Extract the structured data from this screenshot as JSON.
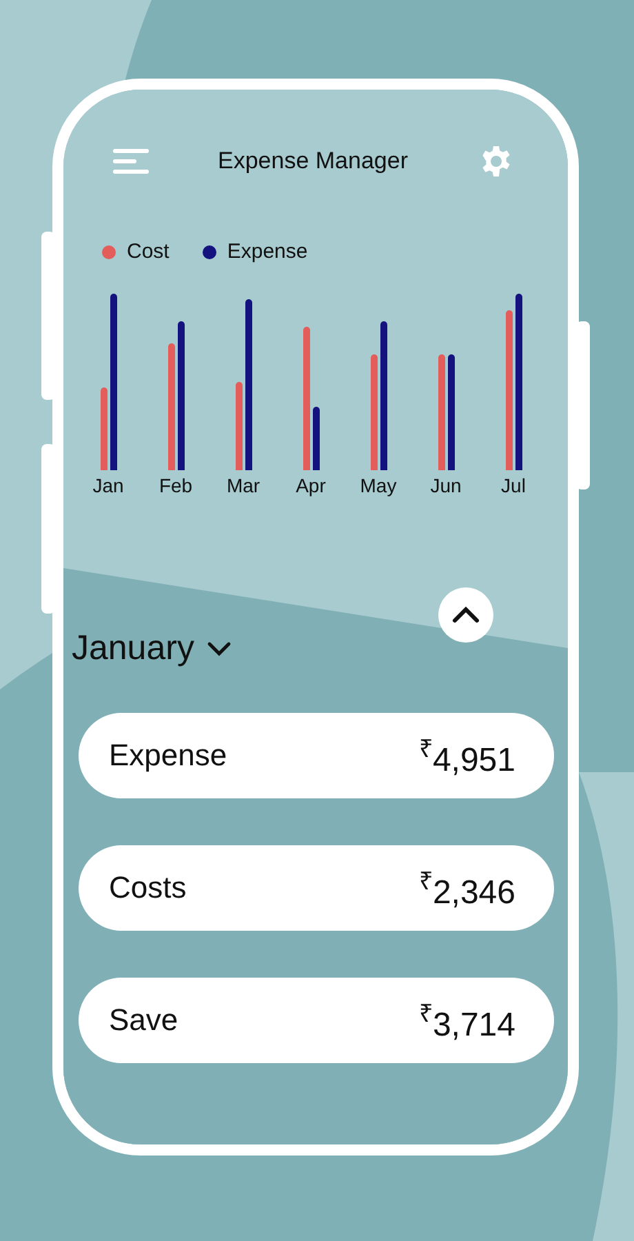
{
  "header": {
    "title": "Expense Manager"
  },
  "legend": [
    {
      "label": "Cost",
      "color": "#e35d5a"
    },
    {
      "label": "Expense",
      "color": "#13127e"
    }
  ],
  "chart_months": [
    "Jan",
    "Feb",
    "Mar",
    "Apr",
    "May",
    "Jun",
    "Jul"
  ],
  "month_selector": {
    "value": "January"
  },
  "summary": [
    {
      "label": "Expense",
      "value": "$^{₹}$4,951"
    },
    {
      "label": "Costs",
      "value": "$^{₹}$2,346"
    },
    {
      "label": "Save",
      "value": "$^{₹}$3,714"
    }
  ]
}
